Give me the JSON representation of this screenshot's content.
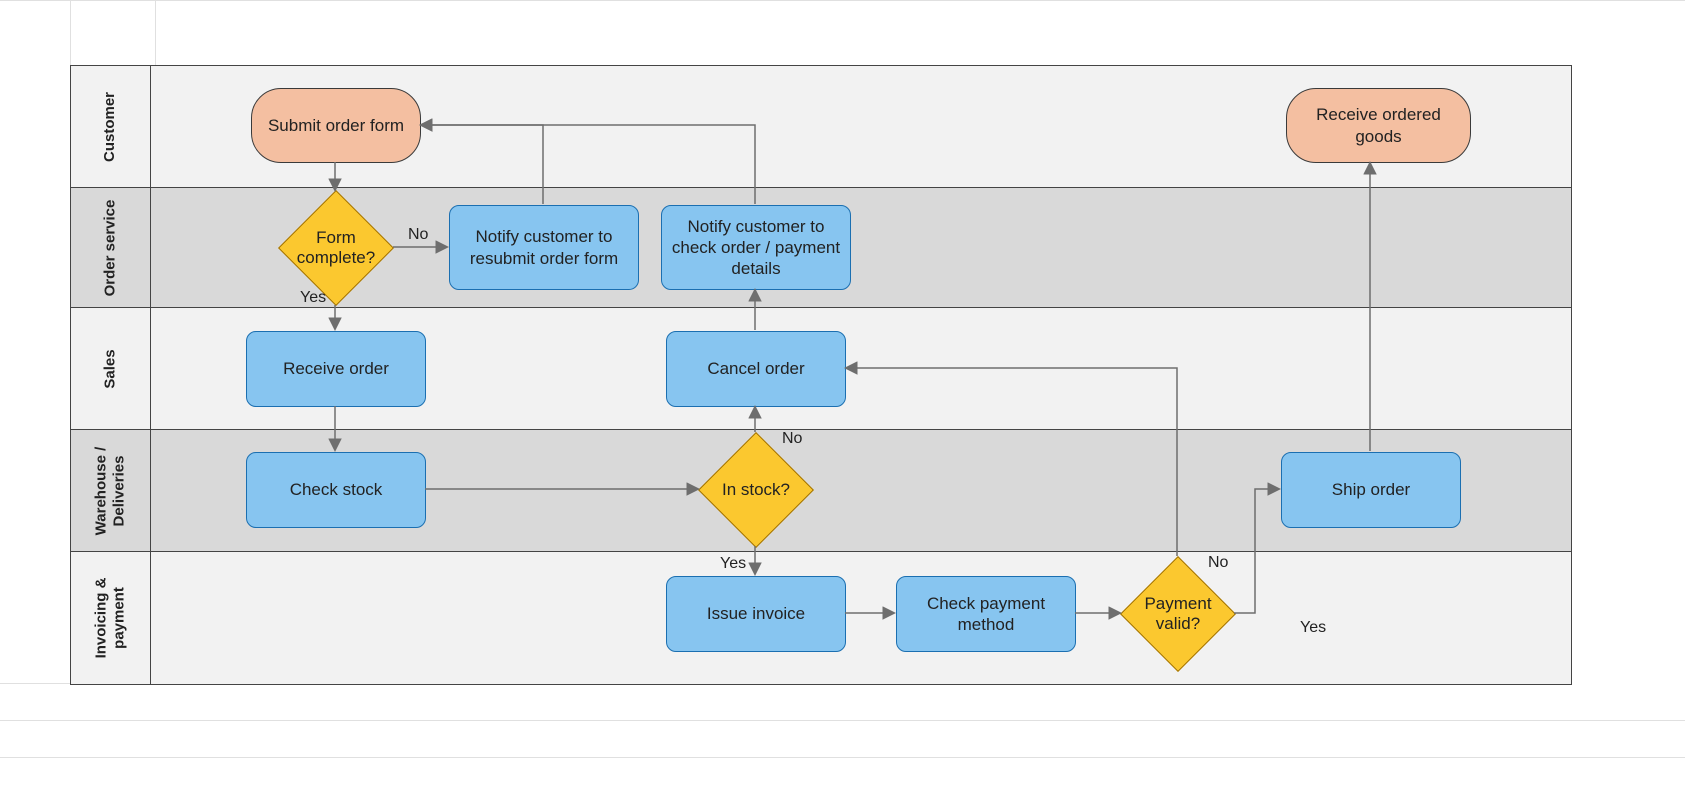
{
  "lanes": [
    {
      "id": "customer",
      "label": "Customer"
    },
    {
      "id": "order_service",
      "label": "Order service"
    },
    {
      "id": "sales",
      "label": "Sales"
    },
    {
      "id": "warehouse",
      "label": "Warehouse /\nDeliveries"
    },
    {
      "id": "invoicing",
      "label": "Invoicing &\npayment"
    }
  ],
  "nodes": {
    "submit_order": "Submit order form",
    "receive_goods": "Receive ordered goods",
    "form_complete": "Form complete?",
    "notify_resubmit": "Notify customer to resubmit order form",
    "notify_check": "Notify customer to check order / payment details",
    "receive_order": "Receive order",
    "cancel_order": "Cancel order",
    "check_stock": "Check stock",
    "in_stock": "In stock?",
    "ship_order": "Ship order",
    "issue_invoice": "Issue invoice",
    "check_payment": "Check payment method",
    "payment_valid": "Payment valid?"
  },
  "edge_labels": {
    "yes1": "Yes",
    "no1": "No",
    "yes2": "Yes",
    "no2": "No",
    "yes3": "Yes",
    "no3": "No"
  },
  "colors": {
    "lane_light": "#f2f2f2",
    "lane_dark": "#d9d9d9",
    "terminator_fill": "#f4bfa1",
    "process_fill": "#87c5f0",
    "decision_fill": "#fbc82f",
    "connector": "#6e6e6e"
  },
  "flow": [
    {
      "from": "submit_order",
      "to": "form_complete"
    },
    {
      "from": "form_complete",
      "to": "notify_resubmit",
      "label": "No"
    },
    {
      "from": "form_complete",
      "to": "receive_order",
      "label": "Yes"
    },
    {
      "from": "notify_resubmit",
      "to": "submit_order"
    },
    {
      "from": "notify_check",
      "to": "submit_order"
    },
    {
      "from": "receive_order",
      "to": "check_stock"
    },
    {
      "from": "check_stock",
      "to": "in_stock"
    },
    {
      "from": "in_stock",
      "to": "cancel_order",
      "label": "No"
    },
    {
      "from": "in_stock",
      "to": "issue_invoice",
      "label": "Yes"
    },
    {
      "from": "cancel_order",
      "to": "notify_check"
    },
    {
      "from": "issue_invoice",
      "to": "check_payment"
    },
    {
      "from": "check_payment",
      "to": "payment_valid"
    },
    {
      "from": "payment_valid",
      "to": "cancel_order",
      "label": "No"
    },
    {
      "from": "payment_valid",
      "to": "ship_order",
      "label": "Yes"
    },
    {
      "from": "ship_order",
      "to": "receive_goods"
    }
  ]
}
